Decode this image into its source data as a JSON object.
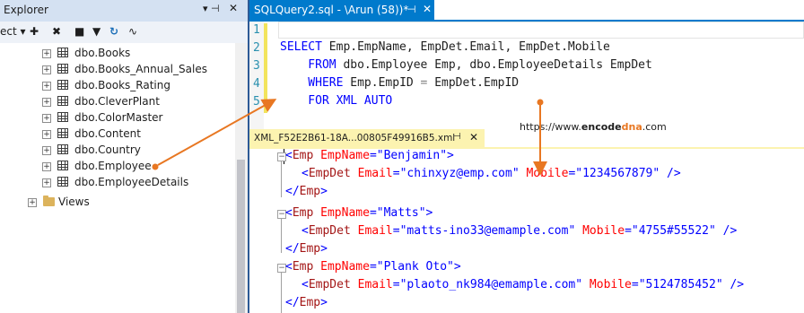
{
  "explorer": {
    "title": "Explorer",
    "toolbar": {
      "connect_label": "ect ▾"
    },
    "tables": [
      "dbo.Books",
      "dbo.Books_Annual_Sales",
      "dbo.Books_Rating",
      "dbo.CleverPlant",
      "dbo.ColorMaster",
      "dbo.Content",
      "dbo.Country",
      "dbo.Employee",
      "dbo.EmployeeDetails"
    ],
    "views_label": "Views"
  },
  "query_tab": {
    "label": "SQLQuery2.sql -    \\Arun (58))*"
  },
  "editor": {
    "line_numbers": [
      "1",
      "2",
      "3",
      "4",
      "5"
    ],
    "lines": [
      {
        "kw1": "SELECT",
        "t1": " Emp.EmpName, EmpDet.Email, EmpDet.Mobile"
      },
      {
        "kw1": "    FROM",
        "t1": " dbo.Employee Emp, dbo.EmployeeDetails EmpDet"
      },
      {
        "kw1": "    WHERE",
        "t1": " Emp.EmpID ",
        "op": "=",
        "t2": " EmpDet.EmpID"
      },
      {
        "kw1": "    FOR XML AUTO",
        "t1": ""
      }
    ]
  },
  "xml_tab": {
    "label": "XML_F52E2B61-18A...00805F49916B5.xml"
  },
  "xml_result": {
    "records": [
      {
        "emp_name": "Benjamin",
        "email": "chinxyz@emp.com",
        "mobile": "1234567879"
      },
      {
        "emp_name": "Matts",
        "email": "matts-ino33@emample.com",
        "mobile": "4755#55522"
      },
      {
        "emp_name": "Plank Oto",
        "email": "plaoto_nk984@emample.com",
        "mobile": "5124785452"
      }
    ]
  },
  "watermark": {
    "prefix": "https://www.",
    "brand_a": "encode",
    "brand_b": "dna",
    "suffix": ".com"
  },
  "colors": {
    "accent": "#007acc",
    "annotation": "#e87722",
    "xml_tab_bg": "#fcf3b0"
  }
}
